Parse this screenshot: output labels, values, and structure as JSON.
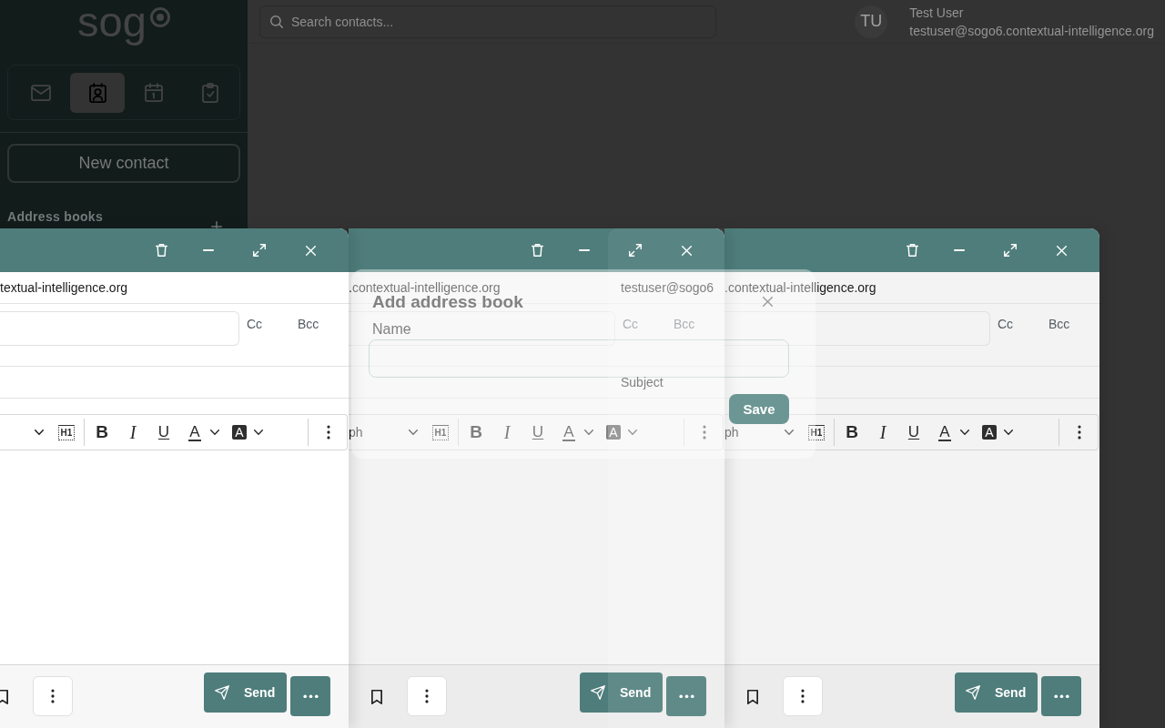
{
  "sidebar": {
    "logo": "sog",
    "apps": [
      {
        "kind": "mail",
        "selected": false
      },
      {
        "kind": "contacts",
        "selected": true
      },
      {
        "kind": "calendar",
        "selected": false
      },
      {
        "kind": "tasks",
        "selected": false
      }
    ],
    "new_contact": "New contact",
    "address_books": "Address books"
  },
  "topbar": {
    "search": {
      "placeholder": "Search contacts..."
    },
    "user": {
      "initials": "TU",
      "name": "Test User",
      "email": "testuser@sogo6.contextual-intelligence.org"
    }
  },
  "compose_windows": [
    {
      "focused": true,
      "from": "textual-intelligence.org",
      "cc": "Cc",
      "bcc": "Bcc",
      "toolbar": [
        {
          "kind": "heading",
          "label": "H1"
        },
        {
          "kind": "bold",
          "label": "B"
        },
        {
          "kind": "italic",
          "label": "I"
        },
        {
          "kind": "underline",
          "label": "U"
        },
        {
          "kind": "text_color",
          "label": "A"
        },
        {
          "kind": "highlight",
          "label": "A"
        }
      ],
      "send": "Send"
    },
    {
      "focused": false,
      "from": ".contextual-intelligence.org",
      "cc": "Cc",
      "bcc": "Bcc",
      "format": "ph",
      "toolbar": [
        {
          "kind": "heading",
          "label": "H1"
        },
        {
          "kind": "bold",
          "label": "B"
        },
        {
          "kind": "italic",
          "label": "I"
        },
        {
          "kind": "underline",
          "label": "U"
        },
        {
          "kind": "text_color",
          "label": "A"
        },
        {
          "kind": "highlight",
          "label": "A"
        }
      ],
      "send": "Send"
    },
    {
      "focused": false,
      "from": ".contextual-intelligence.org",
      "cc": "Cc",
      "bcc": "Bcc",
      "format": "ph",
      "toolbar": [
        {
          "kind": "heading",
          "label": "H1"
        },
        {
          "kind": "bold",
          "label": "B"
        },
        {
          "kind": "italic",
          "label": "I"
        },
        {
          "kind": "underline",
          "label": "U"
        },
        {
          "kind": "text_color",
          "label": "A"
        },
        {
          "kind": "highlight",
          "label": "A"
        }
      ],
      "send": "Send"
    }
  ],
  "overlay": {
    "dialog": {
      "title": "Add address book",
      "field_label": "Name",
      "save": "Save"
    },
    "window": {
      "from": "testuser@sogo6",
      "subject": "Subject"
    }
  }
}
